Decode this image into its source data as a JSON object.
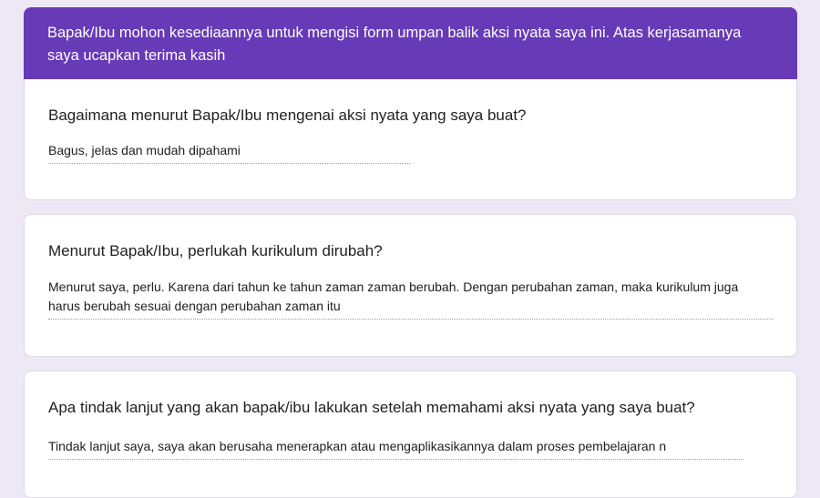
{
  "header": {
    "description": "Bapak/Ibu mohon kesediaannya untuk mengisi form umpan balik aksi nyata saya ini. Atas kerjasamanya saya ucapkan terima kasih"
  },
  "questions": [
    {
      "title": "Bagaimana menurut Bapak/Ibu mengenai aksi nyata yang saya buat?",
      "answer": "Bagus, jelas dan mudah dipahami"
    },
    {
      "title": "Menurut Bapak/Ibu, perlukah kurikulum dirubah?",
      "answer": "Menurut saya, perlu. Karena dari tahun ke tahun zaman zaman berubah. Dengan perubahan zaman, maka kurikulum juga harus berubah sesuai dengan perubahan zaman itu"
    },
    {
      "title": "Apa tindak lanjut yang akan bapak/ibu lakukan setelah memahami aksi nyata yang saya buat?",
      "answer": "Tindak lanjut saya, saya akan berusaha menerapkan atau mengaplikasikannya dalam proses pembelajaran n"
    }
  ],
  "colors": {
    "theme": "#673ab7",
    "background": "#ede7f6"
  }
}
